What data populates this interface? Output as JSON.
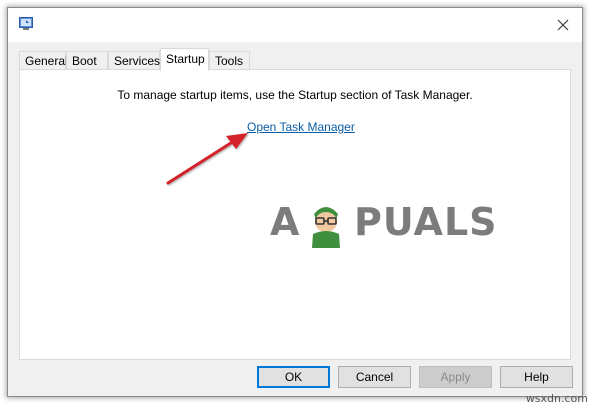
{
  "titlebar": {
    "icon": "msconfig-app-icon",
    "close_icon": "close-icon"
  },
  "tabs": [
    {
      "label": "General",
      "active": false
    },
    {
      "label": "Boot",
      "active": false
    },
    {
      "label": "Services",
      "active": false
    },
    {
      "label": "Startup",
      "active": true
    },
    {
      "label": "Tools",
      "active": false
    }
  ],
  "startup": {
    "message": "To manage startup items, use the Startup section of Task Manager.",
    "link_label": "Open Task Manager",
    "link_color": "#0b5ea8"
  },
  "annotation": {
    "arrow_color": "#d4202a"
  },
  "watermark": {
    "text_left": "A",
    "text_right": "PUALS"
  },
  "buttons": {
    "ok": "OK",
    "cancel": "Cancel",
    "apply": "Apply",
    "help": "Help"
  },
  "footer": {
    "site": "wsxdn.com"
  }
}
